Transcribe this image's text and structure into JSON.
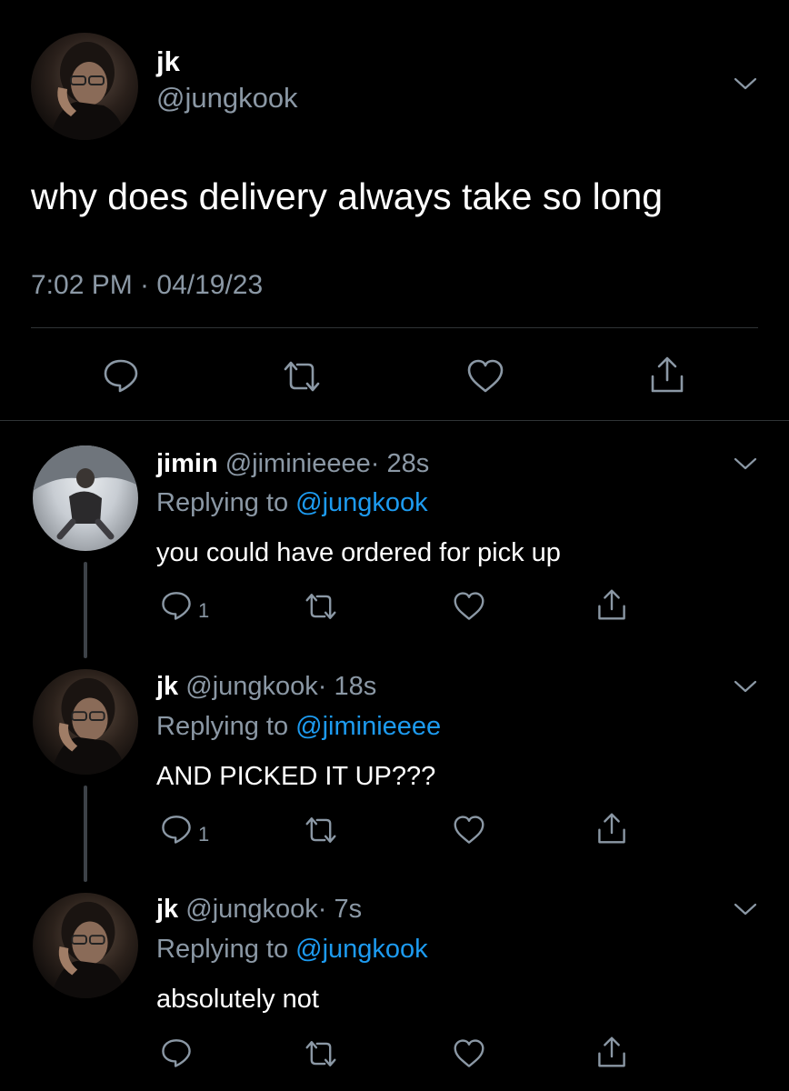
{
  "main_tweet": {
    "author_name": "jk",
    "author_handle": "@jungkook",
    "text": "why does delivery always take so long",
    "timestamp": "7:02 PM · 04/19/23"
  },
  "replies": [
    {
      "author_name": "jimin",
      "author_handle": "@jiminieeee",
      "age": "· 28s",
      "replying_prefix": "Replying to ",
      "replying_to": "@jungkook",
      "text": "you could have ordered for pick up",
      "reply_count": "1"
    },
    {
      "author_name": "jk",
      "author_handle": "@jungkook",
      "age": "· 18s",
      "replying_prefix": "Replying to ",
      "replying_to": "@jiminieeee",
      "text": "AND PICKED IT UP???",
      "reply_count": "1"
    },
    {
      "author_name": "jk",
      "author_handle": "@jungkook",
      "age": "· 7s",
      "replying_prefix": "Replying to ",
      "replying_to": "@jungkook",
      "text": "absolutely not",
      "reply_count": ""
    }
  ],
  "icons": {
    "reply": "reply-icon",
    "retweet": "retweet-icon",
    "like": "heart-icon",
    "share": "share-icon",
    "more": "chevron-down-icon"
  },
  "colors": {
    "background": "#000000",
    "text_primary": "#ffffff",
    "text_secondary": "#8b98a5",
    "mention": "#1d9bf0",
    "divider": "#2f3336"
  }
}
